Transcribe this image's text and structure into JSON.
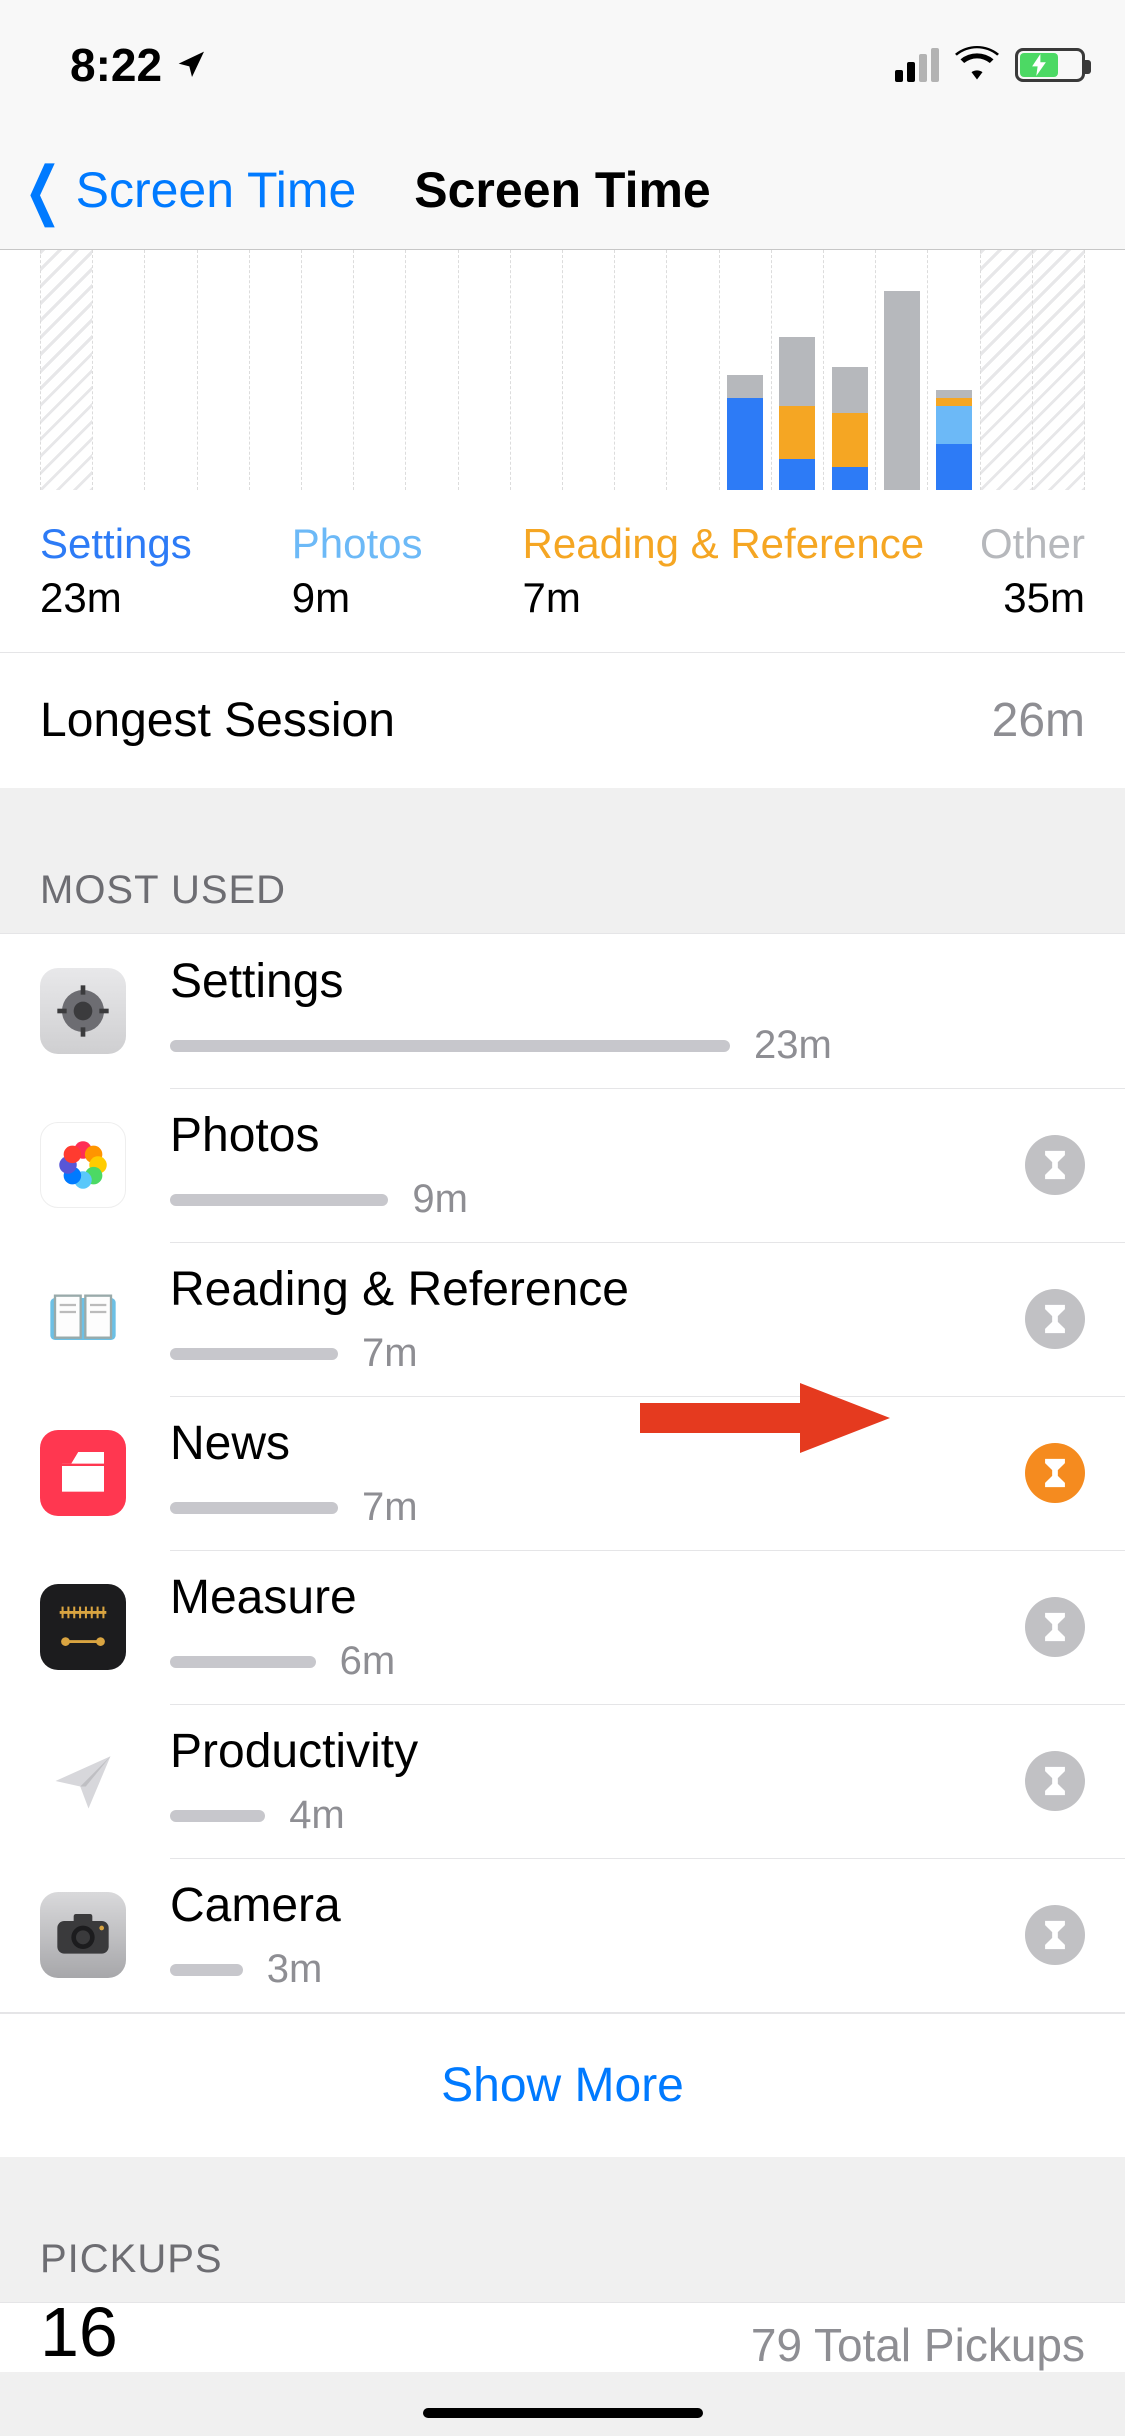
{
  "status": {
    "time": "8:22",
    "location_icon": "location-arrow",
    "signal_bars": 2,
    "wifi": true,
    "battery_charging": true
  },
  "nav": {
    "back_label": "Screen Time",
    "title": "Screen Time"
  },
  "chart_data": {
    "type": "bar",
    "note": "hourly stacked screen-time; only visible columns approximated (minutes per category)",
    "columns": [
      {
        "hatched": true,
        "segments": []
      },
      {
        "hatched": false,
        "segments": []
      },
      {
        "hatched": false,
        "segments": []
      },
      {
        "hatched": false,
        "segments": []
      },
      {
        "hatched": false,
        "segments": []
      },
      {
        "hatched": false,
        "segments": []
      },
      {
        "hatched": false,
        "segments": []
      },
      {
        "hatched": false,
        "segments": []
      },
      {
        "hatched": false,
        "segments": []
      },
      {
        "hatched": false,
        "segments": []
      },
      {
        "hatched": false,
        "segments": []
      },
      {
        "hatched": false,
        "segments": []
      },
      {
        "hatched": false,
        "segments": []
      },
      {
        "hatched": false,
        "segments": [
          {
            "cat": "blue",
            "v": 12
          },
          {
            "cat": "gray",
            "v": 3
          }
        ]
      },
      {
        "hatched": false,
        "segments": [
          {
            "cat": "blue",
            "v": 4
          },
          {
            "cat": "orange",
            "v": 7
          },
          {
            "cat": "gray",
            "v": 9
          }
        ]
      },
      {
        "hatched": false,
        "segments": [
          {
            "cat": "blue",
            "v": 3
          },
          {
            "cat": "orange",
            "v": 7
          },
          {
            "cat": "gray",
            "v": 6
          }
        ]
      },
      {
        "hatched": false,
        "segments": [
          {
            "cat": "gray",
            "v": 26
          }
        ]
      },
      {
        "hatched": false,
        "segments": [
          {
            "cat": "blue",
            "v": 6
          },
          {
            "cat": "lblue",
            "v": 5
          },
          {
            "cat": "orange",
            "v": 1
          },
          {
            "cat": "gray",
            "v": 1
          }
        ]
      },
      {
        "hatched": true,
        "segments": []
      },
      {
        "hatched": true,
        "segments": []
      }
    ],
    "y_max_minutes": 30
  },
  "legend": [
    {
      "key": "settings",
      "label": "Settings",
      "value": "23m",
      "color": "#2d7bf6"
    },
    {
      "key": "photos",
      "label": "Photos",
      "value": "9m",
      "color": "#6cb9f7"
    },
    {
      "key": "reading",
      "label": "Reading & Reference",
      "value": "7m",
      "color": "#f5a623"
    },
    {
      "key": "other",
      "label": "Other",
      "value": "35m",
      "color": "#b6b8bc"
    }
  ],
  "longest_session": {
    "label": "Longest Session",
    "value": "26m"
  },
  "sections": {
    "most_used": "MOST USED",
    "pickups": "PICKUPS"
  },
  "apps": [
    {
      "name": "Settings",
      "time": "23m",
      "bar_pct": 100,
      "limit": null,
      "icon": "settings"
    },
    {
      "name": "Photos",
      "time": "9m",
      "bar_pct": 39,
      "limit": "gray",
      "icon": "photos"
    },
    {
      "name": "Reading & Reference",
      "time": "7m",
      "bar_pct": 30,
      "limit": "gray",
      "icon": "book"
    },
    {
      "name": "News",
      "time": "7m",
      "bar_pct": 30,
      "limit": "orange",
      "icon": "news"
    },
    {
      "name": "Measure",
      "time": "6m",
      "bar_pct": 26,
      "limit": "gray",
      "icon": "measure"
    },
    {
      "name": "Productivity",
      "time": "4m",
      "bar_pct": 17,
      "limit": "gray",
      "icon": "paper-plane"
    },
    {
      "name": "Camera",
      "time": "3m",
      "bar_pct": 13,
      "limit": "gray",
      "icon": "camera"
    }
  ],
  "show_more": "Show More",
  "pickups": {
    "count_partial": "16",
    "total_partial": "79 Total Pickups"
  },
  "annotation": {
    "type": "arrow",
    "target": "news-limit-badge"
  }
}
